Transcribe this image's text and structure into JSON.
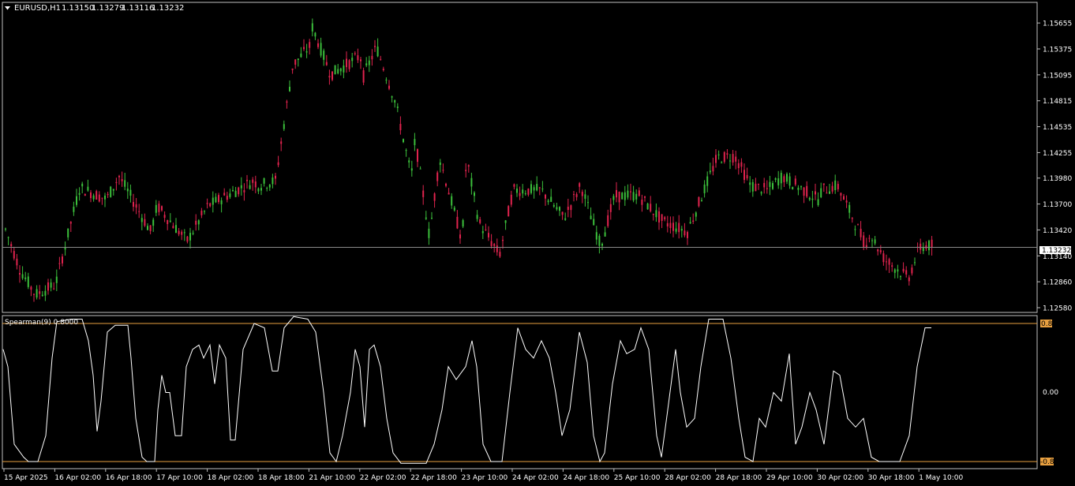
{
  "main_chart": {
    "header_arrow": "triangle-down-icon",
    "symbol": "EURUSD,H1",
    "ohlc": [
      "1.13150",
      "1.13279",
      "1.13116",
      "1.13232"
    ],
    "current_price_label": "1.13232",
    "price_ticks": [
      "1.15655",
      "1.15375",
      "1.15095",
      "1.14815",
      "1.14535",
      "1.14255",
      "1.13980",
      "1.13700",
      "1.13420",
      "1.13140",
      "1.12860",
      "1.12580"
    ],
    "colors": {
      "bull": "#3bbf3b",
      "bear": "#e0234e",
      "wick": "#cccccc",
      "price_line": "#8a8a8a",
      "frame": "#bfbfbf"
    }
  },
  "indicator": {
    "label": "Spearman(9) 0.8000",
    "upper_level_label": "0.8",
    "zero_label": "0.00",
    "lower_level_label": "-0.8",
    "level_color": "#e8a040",
    "line_color": "#ffffff"
  },
  "time_axis": [
    "15 Apr 2025",
    "16 Apr 02:00",
    "16 Apr 18:00",
    "17 Apr 10:00",
    "18 Apr 02:00",
    "18 Apr 18:00",
    "21 Apr 10:00",
    "22 Apr 02:00",
    "22 Apr 18:00",
    "23 Apr 10:00",
    "24 Apr 02:00",
    "24 Apr 18:00",
    "25 Apr 10:00",
    "28 Apr 02:00",
    "28 Apr 18:00",
    "29 Apr 10:00",
    "30 Apr 02:00",
    "30 Apr 18:00",
    "1 May 10:00"
  ],
  "chart_data": {
    "type": "candlestick",
    "symbol": "EURUSD",
    "timeframe": "H1",
    "ylim": [
      1.1258,
      1.1575
    ],
    "close_path": [
      {
        "t": "15 Apr 2025",
        "close": 1.1345
      },
      {
        "t": "16 Apr 02:00",
        "close": 1.1283
      },
      {
        "t": "16 Apr 18:00",
        "close": 1.1375
      },
      {
        "t": "17 Apr 10:00",
        "close": 1.1368
      },
      {
        "t": "18 Apr 02:00",
        "close": 1.1368
      },
      {
        "t": "18 Apr 18:00",
        "close": 1.139
      },
      {
        "t": "21 Apr 10:00",
        "close": 1.154
      },
      {
        "t": "22 Apr 02:00",
        "close": 1.153
      },
      {
        "t": "22 Apr 18:00",
        "close": 1.14
      },
      {
        "t": "23 Apr 10:00",
        "close": 1.133
      },
      {
        "t": "24 Apr 02:00",
        "close": 1.1385
      },
      {
        "t": "24 Apr 18:00",
        "close": 1.1355
      },
      {
        "t": "25 Apr 10:00",
        "close": 1.1378
      },
      {
        "t": "28 Apr 02:00",
        "close": 1.135
      },
      {
        "t": "28 Apr 18:00",
        "close": 1.1418
      },
      {
        "t": "29 Apr 10:00",
        "close": 1.1385
      },
      {
        "t": "30 Apr 02:00",
        "close": 1.1375
      },
      {
        "t": "30 Apr 18:00",
        "close": 1.1318
      },
      {
        "t": "1 May 10:00",
        "close": 1.1323
      }
    ],
    "last_bar": {
      "open": 1.1315,
      "high": 1.13279,
      "low": 1.13116,
      "close": 1.13232
    },
    "indicator": {
      "name": "Spearman(9)",
      "levels": [
        0.8,
        0.0,
        -0.8
      ],
      "ylim": [
        -0.85,
        0.87
      ]
    }
  }
}
